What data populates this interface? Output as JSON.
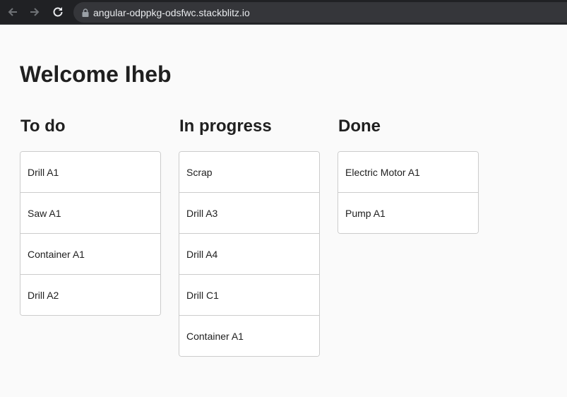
{
  "browser": {
    "url": "angular-odppkg-odsfwc.stackblitz.io",
    "icons": {
      "back": "arrow-left-icon",
      "forward": "arrow-right-icon",
      "reload": "reload-icon",
      "lock": "lock-icon"
    }
  },
  "page": {
    "title": "Welcome Iheb"
  },
  "columns": [
    {
      "title": "To do",
      "items": [
        "Drill A1",
        "Saw A1",
        "Container A1",
        "Drill A2"
      ]
    },
    {
      "title": "In progress",
      "items": [
        "Scrap",
        "Drill A3",
        "Drill A4",
        "Drill C1",
        "Container A1"
      ]
    },
    {
      "title": "Done",
      "items": [
        "Electric Motor A1",
        "Pump A1"
      ]
    }
  ],
  "colors": {
    "page_background": "#fafafa",
    "card_border": "#cccccc",
    "browser_bar": "#202124",
    "address_bar": "#35363a"
  }
}
